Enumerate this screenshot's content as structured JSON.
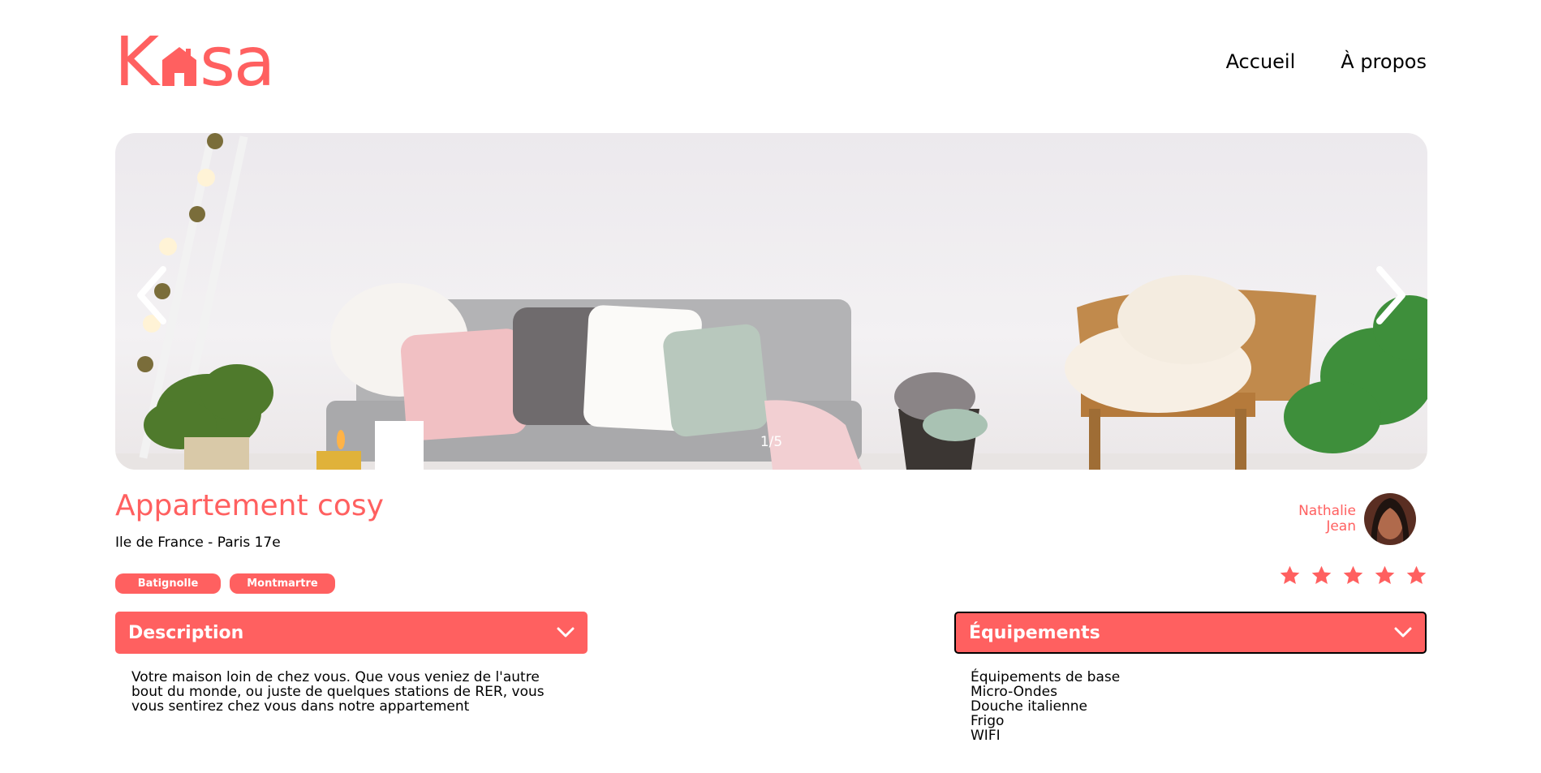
{
  "header": {
    "logo_left": "K",
    "logo_right": "sa",
    "nav": [
      {
        "label": "Accueil"
      },
      {
        "label": "À propos"
      }
    ]
  },
  "carousel": {
    "counter": "1/5",
    "prev_icon": "chevron-left-icon",
    "next_icon": "chevron-right-icon"
  },
  "listing": {
    "title": "Appartement cosy",
    "location": "Ile de France - Paris 17e",
    "tags": [
      "Batignolle",
      "Montmartre"
    ],
    "host": {
      "first_name": "Nathalie",
      "last_name": "Jean"
    },
    "rating": 5,
    "rating_max": 5
  },
  "description": {
    "title": "Description",
    "text": "Votre maison loin de chez vous. Que vous veniez de l'autre bout du monde, ou juste de quelques stations de RER, vous vous sentirez chez vous dans notre appartement"
  },
  "equipments": {
    "title": "Équipements",
    "items": [
      "Équipements de base",
      "Micro-Ondes",
      "Douche italienne",
      "Frigo",
      "WIFI"
    ]
  },
  "colors": {
    "accent": "#FF6060",
    "text": "#000000",
    "background": "#FFFFFF"
  }
}
